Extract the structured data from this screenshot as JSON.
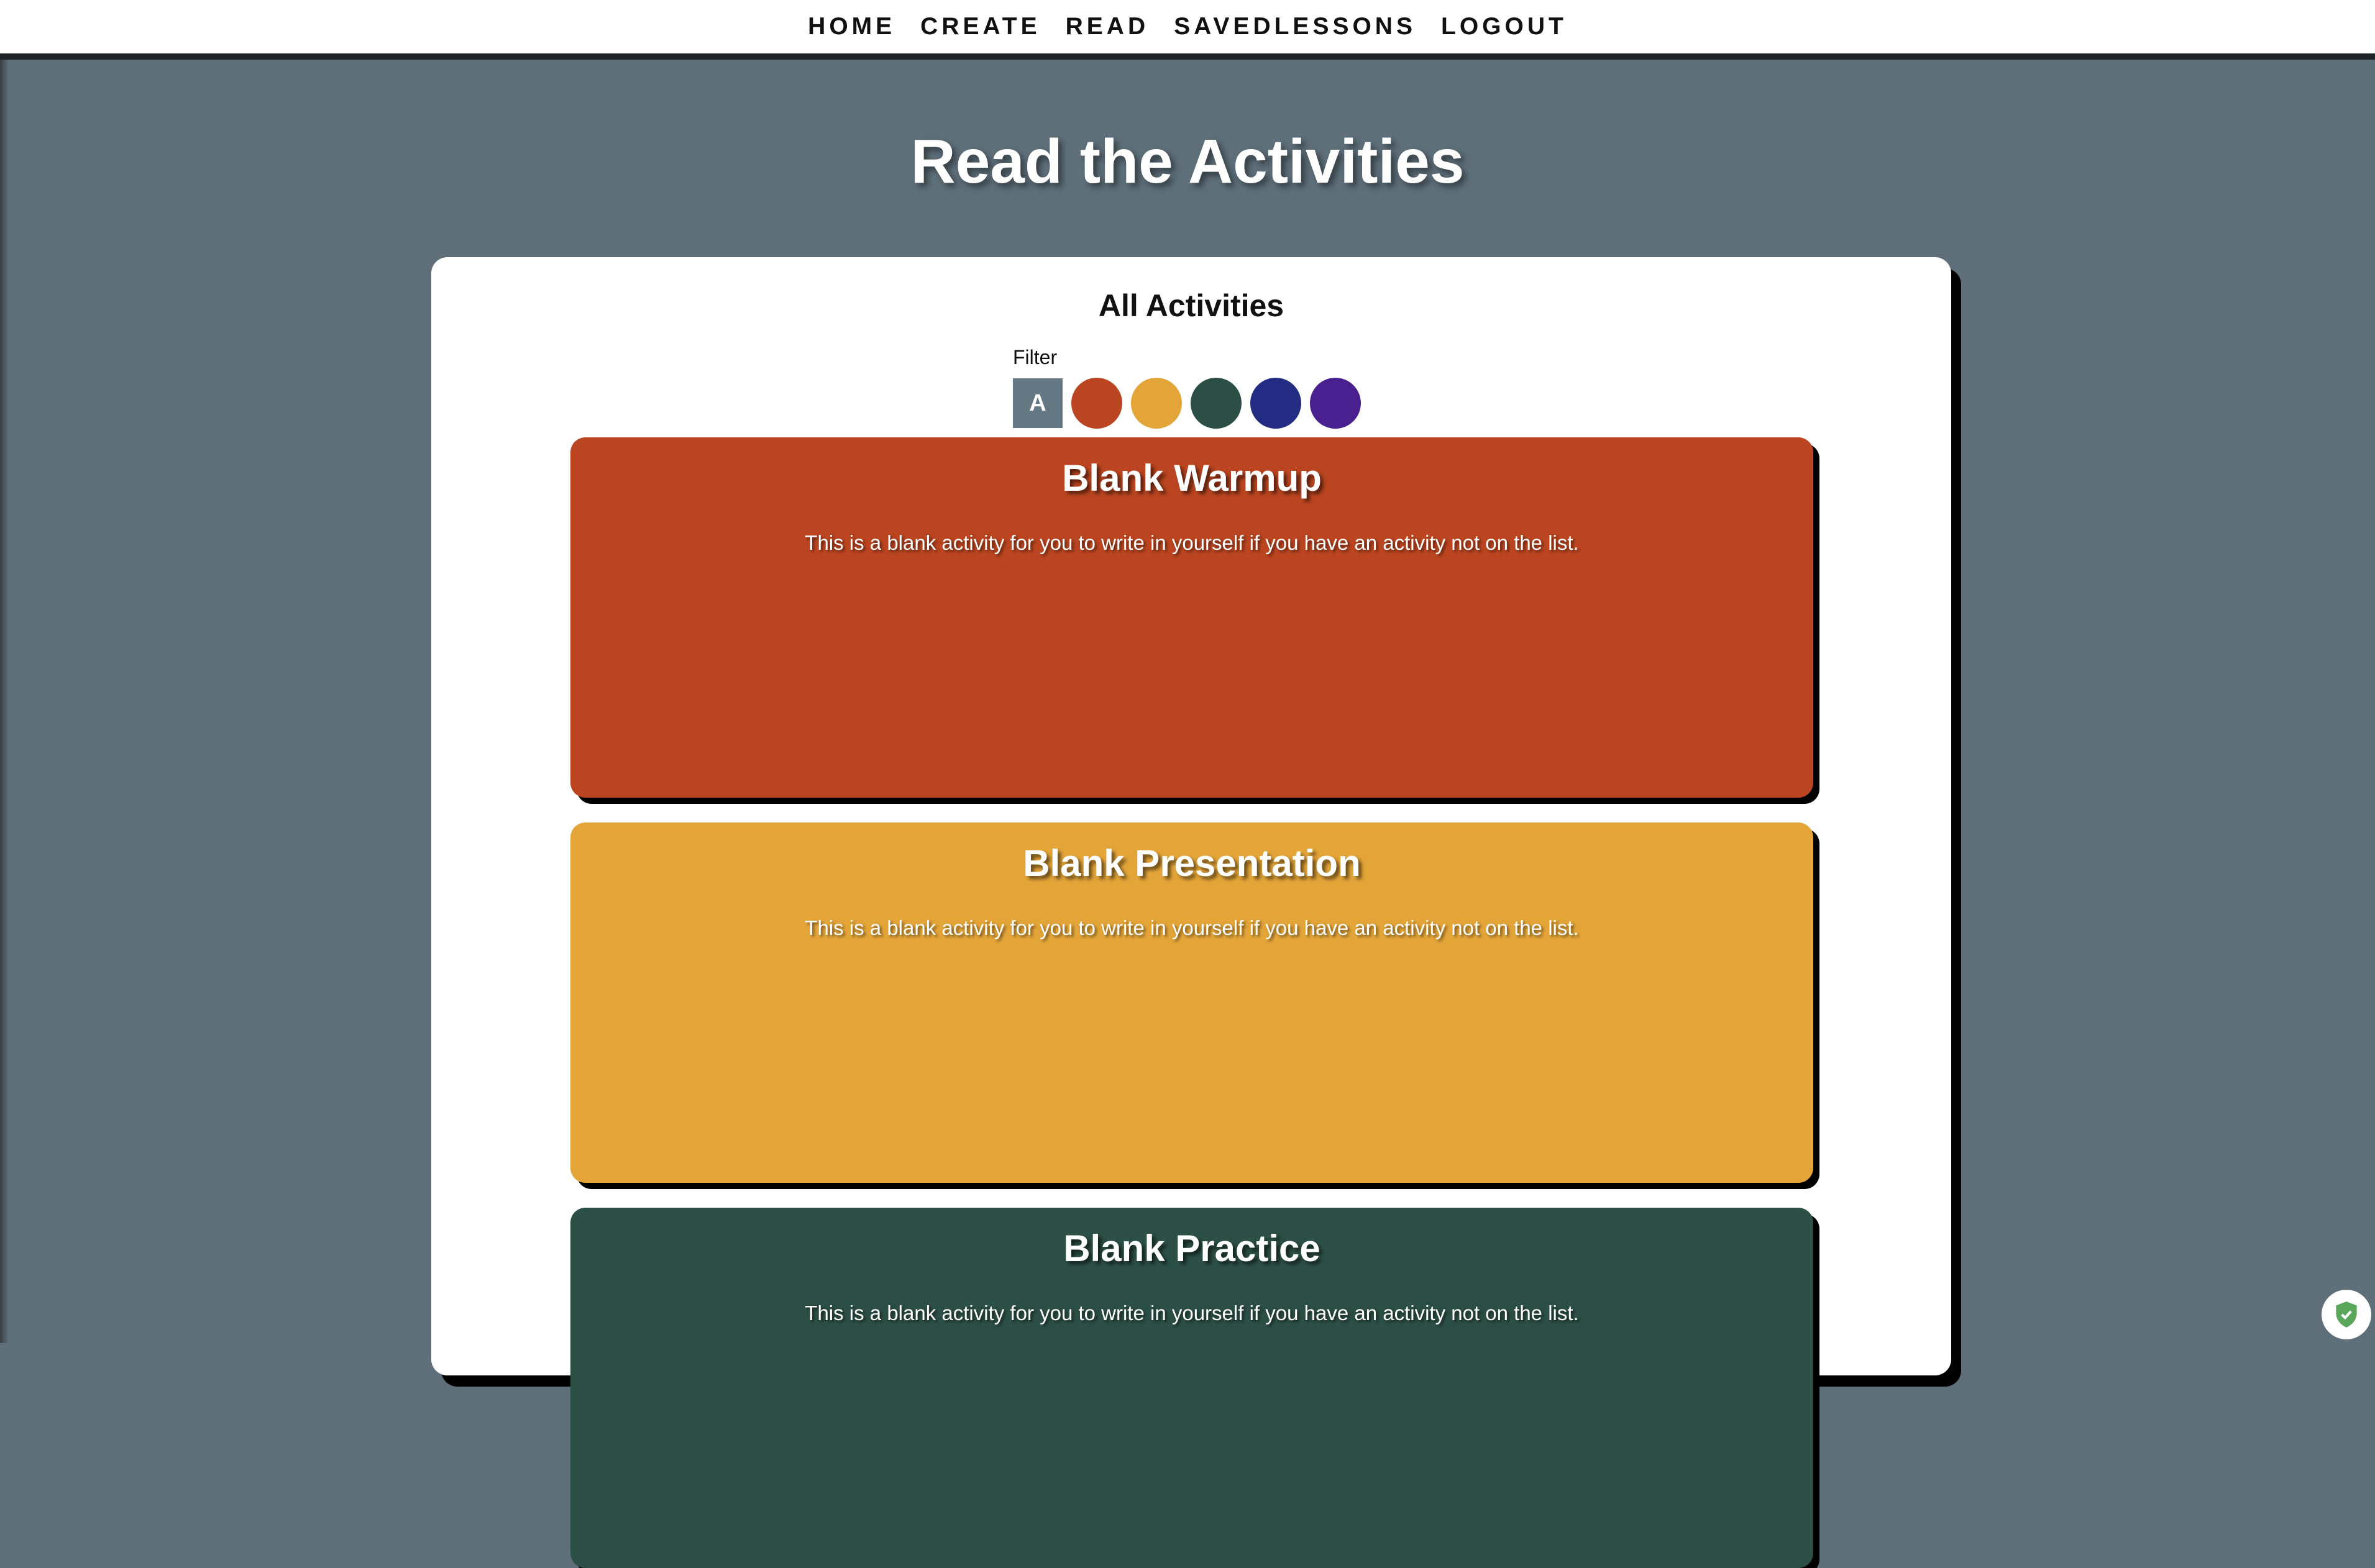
{
  "nav": {
    "items": [
      {
        "label": "HOME"
      },
      {
        "label": "CREATE"
      },
      {
        "label": "READ"
      },
      {
        "label": "SAVEDLESSONS"
      },
      {
        "label": "LOGOUT"
      }
    ]
  },
  "page": {
    "title": "Read the Activities"
  },
  "panel": {
    "title": "All Activities",
    "filter_label": "Filter",
    "filter_all_label": "A",
    "filter_colors": [
      "#bb4520",
      "#e4a538",
      "#2c4f45",
      "#232c83",
      "#4a1f8f"
    ]
  },
  "activities": [
    {
      "title": "Blank Warmup",
      "description": "This is a blank activity for you to write in yourself if you have an activity not on the list.",
      "color": "#bb4520"
    },
    {
      "title": "Blank Presentation",
      "description": "This is a blank activity for you to write in yourself if you have an activity not on the list.",
      "color": "#e4a538"
    },
    {
      "title": "Blank Practice",
      "description": "This is a blank activity for you to write in yourself if you have an activity not on the list.",
      "color": "#2c4f45"
    }
  ],
  "badge": {
    "icon": "shield-check-icon"
  }
}
